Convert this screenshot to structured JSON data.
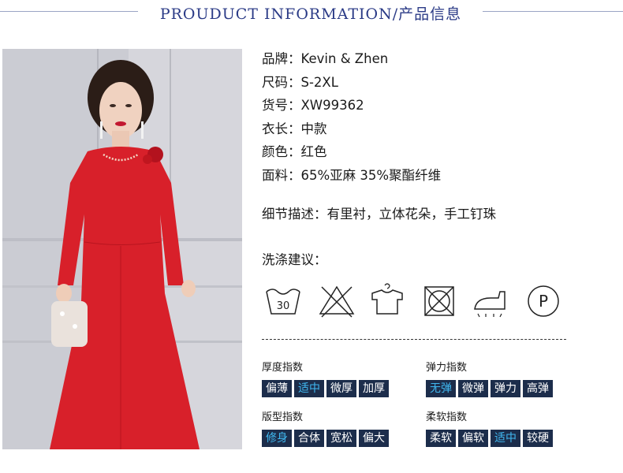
{
  "header": {
    "title": "PROUDUCT INFORMATION/产品信息"
  },
  "info": [
    {
      "label": "品牌：",
      "value": "Kevin & Zhen"
    },
    {
      "label": "尺码：",
      "value": "S-2XL"
    },
    {
      "label": "货号：",
      "value": "XW99362"
    },
    {
      "label": "衣长：",
      "value": "中款"
    },
    {
      "label": "颜色：",
      "value": "红色"
    },
    {
      "label": "面料：",
      "value": "65%亚麻 35%聚酯纤维"
    }
  ],
  "detail": {
    "text": "细节描述：有里衬，立体花朵，手工钉珠"
  },
  "wash": {
    "title": "洗涤建议：",
    "icons": [
      {
        "name": "wash-30-icon",
        "text": "30"
      },
      {
        "name": "no-bleach-icon"
      },
      {
        "name": "hang-dry-icon"
      },
      {
        "name": "no-tumble-dry-icon"
      },
      {
        "name": "iron-icon"
      },
      {
        "name": "professional-clean-icon",
        "text": "P"
      }
    ]
  },
  "indices": {
    "thickness": {
      "title": "厚度指数",
      "options": [
        "偏薄",
        "适中",
        "微厚",
        "加厚"
      ],
      "active": 1
    },
    "elasticity": {
      "title": "弹力指数",
      "options": [
        "无弹",
        "微弹",
        "弹力",
        "高弹"
      ],
      "active": 0
    },
    "fit": {
      "title": "版型指数",
      "options": [
        "修身",
        "合体",
        "宽松",
        "偏大"
      ],
      "active": 0
    },
    "softness": {
      "title": "柔软指数",
      "options": [
        "柔软",
        "偏软",
        "适中",
        "较硬"
      ],
      "active": 2
    }
  },
  "colors": {
    "header": "#2a3a86",
    "chip_bg": "#1c2d4b",
    "chip_active": "#40b8f0",
    "dress": "#d8202a"
  }
}
